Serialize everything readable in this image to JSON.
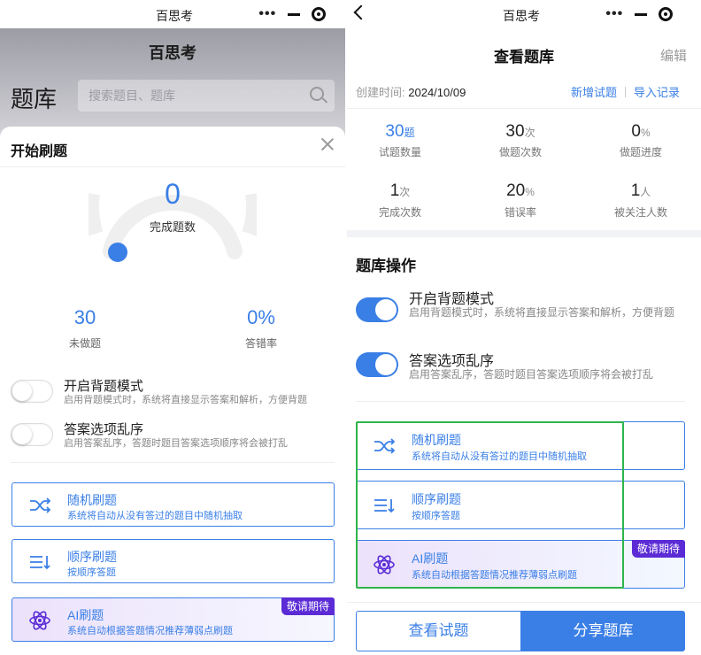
{
  "left": {
    "status_title": "百思考",
    "app_title": "百思考",
    "bank_label": "题库",
    "search_placeholder": "搜索题目、题库",
    "sheet": {
      "title": "开始刷题",
      "gauge_value": "0",
      "gauge_label": "完成题数",
      "stats": [
        {
          "value": "30",
          "label": "未做题"
        },
        {
          "value": "0%",
          "label": "答错率"
        }
      ],
      "toggles": [
        {
          "title": "开启背题模式",
          "desc": "启用背题模式时，系统将直接显示答案和解析，方便背题",
          "on": false
        },
        {
          "title": "答案选项乱序",
          "desc": "启用答案乱序，答题时题目答案选项顺序将会被打乱",
          "on": false
        }
      ],
      "modes": [
        {
          "icon": "shuffle-icon",
          "title": "随机刷题",
          "desc": "系统将自动从没有答过的题目中随机抽取"
        },
        {
          "icon": "sequence-icon",
          "title": "顺序刷题",
          "desc": "按顺序答题"
        },
        {
          "icon": "atom-icon",
          "title": "AI刷题",
          "desc": "系统自动根据答题情况推荐薄弱点刷题",
          "badge": "敬请期待"
        }
      ]
    }
  },
  "right": {
    "status_title": "百思考",
    "title": "查看题库",
    "edit_label": "编辑",
    "created_label": "创建时间:",
    "created_date": "2024/10/09",
    "link_new": "新增试题",
    "link_import": "导入记录",
    "stats": [
      {
        "value": "30",
        "unit": "题",
        "label": "试题数量",
        "blue": true
      },
      {
        "value": "30",
        "unit": "次",
        "label": "做题次数",
        "blue": false
      },
      {
        "value": "0",
        "unit": "%",
        "label": "做题进度",
        "blue": false
      },
      {
        "value": "1",
        "unit": "次",
        "label": "完成次数",
        "blue": false
      },
      {
        "value": "20",
        "unit": "%",
        "label": "错误率",
        "blue": false
      },
      {
        "value": "1",
        "unit": "人",
        "label": "被关注人数",
        "blue": false
      }
    ],
    "section_title": "题库操作",
    "toggles": [
      {
        "title": "开启背题模式",
        "desc": "启用背题模式时，系统将直接显示答案和解析，方便背题",
        "on": true
      },
      {
        "title": "答案选项乱序",
        "desc": "启用答案乱序，答题时题目答案选项顺序将会被打乱",
        "on": true
      }
    ],
    "modes": [
      {
        "icon": "shuffle-icon",
        "title": "随机刷题",
        "desc": "系统将自动从没有答过的题目中随机抽取"
      },
      {
        "icon": "sequence-icon",
        "title": "顺序刷题",
        "desc": "按顺序答题"
      },
      {
        "icon": "atom-icon",
        "title": "AI刷题",
        "desc": "系统自动根据答题情况推荐薄弱点刷题",
        "badge": "敬请期待"
      }
    ],
    "btn_view": "查看试题",
    "btn_share": "分享题库"
  },
  "colors": {
    "accent": "#3a7fe6",
    "badge": "#5b2bd6",
    "highlight": "#2fb44a"
  }
}
